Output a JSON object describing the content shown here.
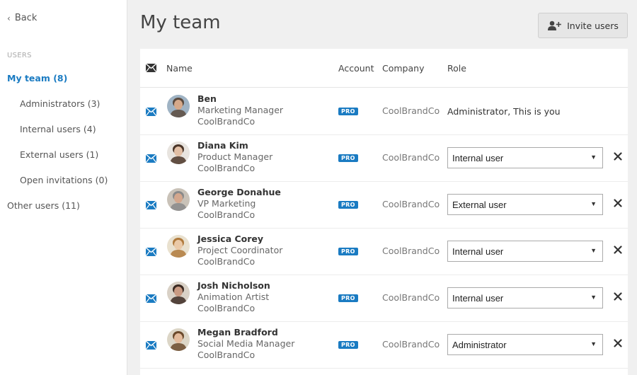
{
  "sidebar": {
    "back_label": "Back",
    "section_label": "USERS",
    "items": [
      {
        "label": "My team (8)",
        "active": true
      },
      {
        "label": "Administrators (3)"
      },
      {
        "label": "Internal users (4)"
      },
      {
        "label": "External users (1)"
      },
      {
        "label": "Open invitations (0)"
      },
      {
        "label": "Other users (11)"
      }
    ]
  },
  "header": {
    "title": "My team",
    "invite_label": "Invite users"
  },
  "table": {
    "columns": {
      "name": "Name",
      "account": "Account",
      "company": "Company",
      "role": "Role"
    },
    "rows": [
      {
        "name": "Ben",
        "title": "Marketing Manager",
        "company_line": "CoolBrandCo",
        "account": "PRO",
        "company": "CoolBrandCo",
        "role": "Administrator, This is you",
        "editable": false
      },
      {
        "name": "Diana Kim",
        "title": "Product Manager",
        "company_line": "CoolBrandCo",
        "account": "PRO",
        "company": "CoolBrandCo",
        "role": "Internal user",
        "editable": true
      },
      {
        "name": "George Donahue",
        "title": "VP Marketing",
        "company_line": "CoolBrandCo",
        "account": "PRO",
        "company": "CoolBrandCo",
        "role": "External user",
        "editable": true
      },
      {
        "name": "Jessica Corey",
        "title": "Project Coordinator",
        "company_line": "CoolBrandCo",
        "account": "PRO",
        "company": "CoolBrandCo",
        "role": "Internal user",
        "editable": true
      },
      {
        "name": "Josh Nicholson",
        "title": "Animation Artist",
        "company_line": "CoolBrandCo",
        "account": "PRO",
        "company": "CoolBrandCo",
        "role": "Internal user",
        "editable": true
      },
      {
        "name": "Megan Bradford",
        "title": "Social Media Manager",
        "company_line": "CoolBrandCo",
        "account": "PRO",
        "company": "CoolBrandCo",
        "role": "Administrator",
        "editable": true
      }
    ]
  },
  "colors": {
    "accent": "#1a7bc2",
    "background": "#f0f0f0"
  }
}
